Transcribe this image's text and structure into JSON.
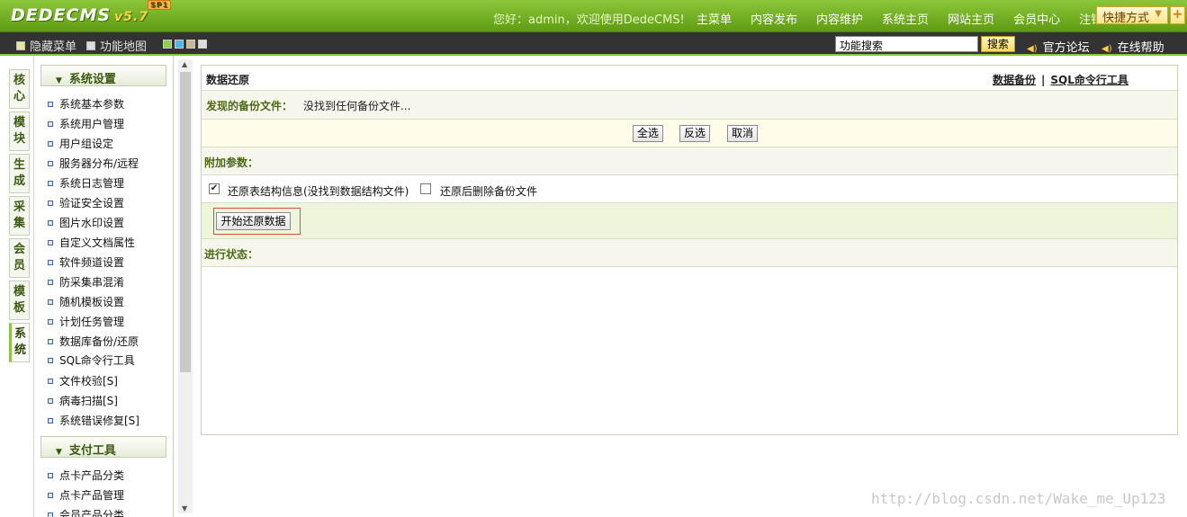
{
  "header": {
    "logo_text": "DEDECMS",
    "version": "v5.7",
    "sp_badge": "SP1",
    "welcome": "您好：admin，欢迎使用DedeCMS!",
    "nav": [
      "主菜单",
      "内容发布",
      "内容维护",
      "系统主页",
      "网站主页",
      "会员中心",
      "注销"
    ],
    "quick_label": "快捷方式",
    "quick_arrow": "▼",
    "quick_plus": "+"
  },
  "subbar": {
    "hide_menu": "隐藏菜单",
    "site_map": "功能地图",
    "search_placeholder": "功能搜索",
    "search_button": "搜索",
    "forum": "官方论坛",
    "help": "在线帮助",
    "swatch_colors": [
      "#8fd14f",
      "#4db8e8",
      "#c9b68a",
      "#dcdcdc"
    ]
  },
  "vtabs": [
    {
      "label": "核心",
      "c1": "核",
      "c2": "心"
    },
    {
      "label": "模块",
      "c1": "模",
      "c2": "块"
    },
    {
      "label": "生成",
      "c1": "生",
      "c2": "成"
    },
    {
      "label": "采集",
      "c1": "采",
      "c2": "集"
    },
    {
      "label": "会员",
      "c1": "会",
      "c2": "员"
    },
    {
      "label": "模板",
      "c1": "模",
      "c2": "板"
    },
    {
      "label": "系统",
      "c1": "系",
      "c2": "统"
    }
  ],
  "menu": {
    "group1_title": "系统设置",
    "group1_items": [
      "系统基本参数",
      "系统用户管理",
      "用户组设定",
      "服务器分布/远程",
      "系统日志管理",
      "验证安全设置",
      "图片水印设置",
      "自定义文档属性",
      "软件频道设置",
      "防采集串混淆",
      "随机模板设置",
      "计划任务管理",
      "数据库备份/还原",
      "SQL命令行工具",
      "文件校验[S]",
      "病毒扫描[S]",
      "系统错误修复[S]"
    ],
    "group2_title": "支付工具",
    "group2_items": [
      "点卡产品分类",
      "点卡产品管理",
      "会员产品分类"
    ]
  },
  "main": {
    "title": "数据还原",
    "link_backup": "数据备份",
    "link_sep": "|",
    "link_sql": "SQL命令行工具",
    "found_label": "发现的备份文件：",
    "found_value": "没找到任何备份文件...",
    "btn_select_all": "全选",
    "btn_invert": "反选",
    "btn_cancel": "取消",
    "extra_label": "附加参数：",
    "opt1_label": "还原表结构信息(没找到数据结构文件)",
    "opt1_checked": true,
    "opt2_label": "还原后删除备份文件",
    "opt2_checked": false,
    "start_button": "开始还原数据",
    "status_label": "进行状态："
  },
  "watermark": "http://blog.csdn.net/Wake_me_Up123"
}
